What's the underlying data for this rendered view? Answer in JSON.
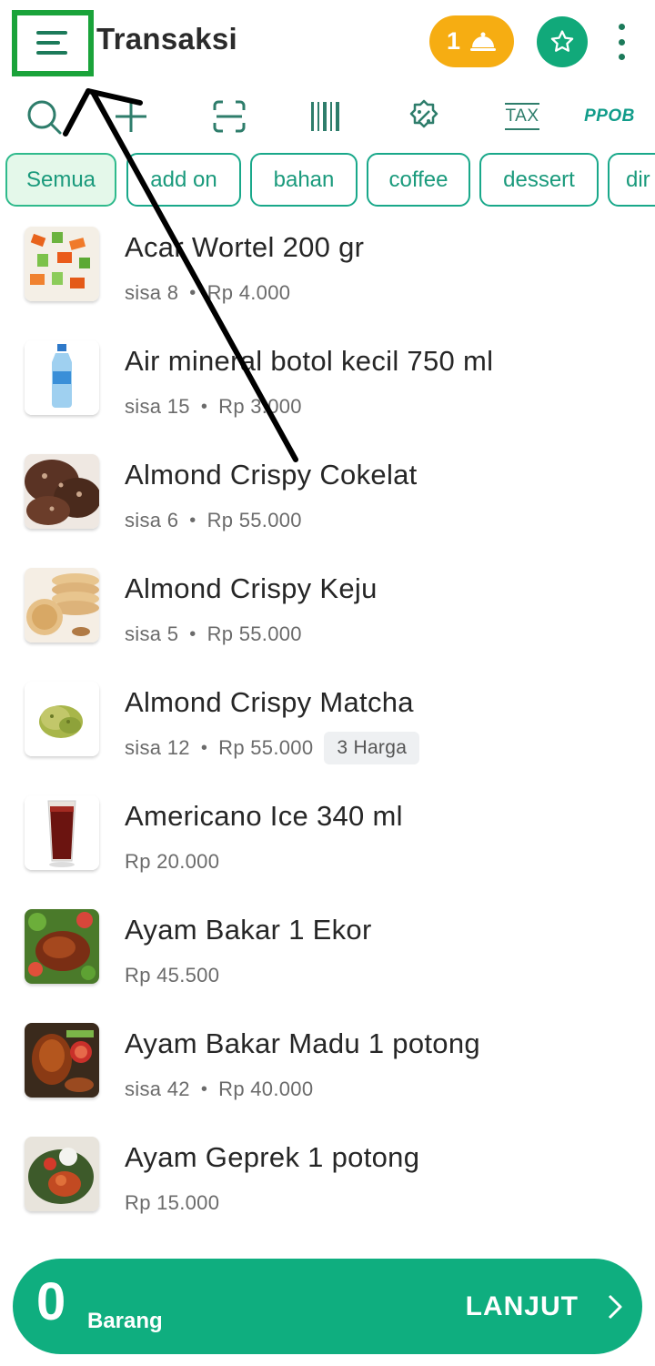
{
  "header": {
    "title": "Transaksi",
    "order_count": "1"
  },
  "toolbar": {
    "tax_label": "TAX",
    "ppob_label": "PPOB"
  },
  "categories": [
    "Semua",
    "add on",
    "bahan",
    "coffee",
    "dessert",
    "dir"
  ],
  "products": [
    {
      "name": "Acar Wortel 200 gr",
      "stock": "sisa 8",
      "price": "Rp 4.000",
      "badge": ""
    },
    {
      "name": "Air mineral botol kecil 750 ml",
      "stock": "sisa 15",
      "price": "Rp 3.000",
      "badge": ""
    },
    {
      "name": "Almond Crispy Cokelat",
      "stock": "sisa 6",
      "price": "Rp 55.000",
      "badge": ""
    },
    {
      "name": "Almond Crispy Keju",
      "stock": "sisa 5",
      "price": "Rp 55.000",
      "badge": ""
    },
    {
      "name": "Almond Crispy Matcha",
      "stock": "sisa 12",
      "price": "Rp 55.000",
      "badge": "3 Harga"
    },
    {
      "name": "Americano Ice 340 ml",
      "stock": "",
      "price": "Rp 20.000",
      "badge": ""
    },
    {
      "name": "Ayam Bakar 1 Ekor",
      "stock": "",
      "price": "Rp 45.500",
      "badge": ""
    },
    {
      "name": "Ayam Bakar Madu 1 potong",
      "stock": "sisa 42",
      "price": "Rp 40.000",
      "badge": ""
    },
    {
      "name": "Ayam Geprek 1 potong",
      "stock": "",
      "price": "Rp 15.000",
      "badge": ""
    }
  ],
  "bottom_bar": {
    "count": "0",
    "count_label": "Barang",
    "next_label": "LANJUT"
  },
  "colors": {
    "brand_green": "#0fae7f",
    "order_orange": "#f6ad12",
    "highlight_green": "#1aa33a"
  }
}
